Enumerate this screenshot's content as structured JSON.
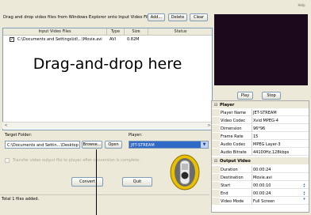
{
  "topbar": {
    "help_label": "Help"
  },
  "instruction": "Drag and drop video files from Windows Explorer onto Input Video Files...",
  "toolbar": {
    "add_label": "Add...",
    "delete_label": "Delete",
    "clear_label": "Clear"
  },
  "table": {
    "columns": [
      "Input Video Files",
      "Type",
      "Size",
      "Status"
    ],
    "rows": [
      {
        "checked": true,
        "file": "C:\\Documents and Settings\\id\\...\\Movie.avi",
        "type": "AVI",
        "size": "0.82M",
        "status": ""
      }
    ],
    "drop_hint": "Drag-and-drop here"
  },
  "target": {
    "label": "Target Folder:",
    "value": "C:\\Documents and Settin...\\Desktop",
    "browse_label": "Browse...",
    "open_label": "Open"
  },
  "player_field": {
    "label": "Player:",
    "value": "JET-STREAM"
  },
  "transfer": {
    "label": "Transfer video output file to player after conversion is complete.",
    "checked": false
  },
  "actions": {
    "convert_label": "Convert",
    "quit_label": "Quit"
  },
  "status_text": "Total 1 files added.",
  "preview": {
    "play_label": "Play",
    "stop_label": "Stop"
  },
  "props": {
    "player_section": "Player",
    "player_rows": [
      {
        "key": "Player Name",
        "value": "JET-STREAM"
      },
      {
        "key": "Video Codec",
        "value": "Xvid MPEG-4"
      },
      {
        "key": "Dimension",
        "value": "96*96"
      },
      {
        "key": "Frame Rate",
        "value": "15"
      },
      {
        "key": "Audio Codec",
        "value": "MPEG Layer-3"
      },
      {
        "key": "Audio Bitrate",
        "value": "44100Hz,128kbps"
      }
    ],
    "output_section": "Output Video",
    "output_rows": [
      {
        "key": "Duration",
        "value": "00:00:24"
      },
      {
        "key": "Destination",
        "value": "Movie.avi"
      },
      {
        "key": "Start",
        "value": "00:00:10"
      },
      {
        "key": "End",
        "value": "00:00:24"
      },
      {
        "key": "Video Mode",
        "value": "Full Screen"
      }
    ]
  },
  "colors": {
    "window_bg": "#ece9d8",
    "selection_blue": "#3169c6",
    "preview_bg": "#1a0a1c"
  }
}
